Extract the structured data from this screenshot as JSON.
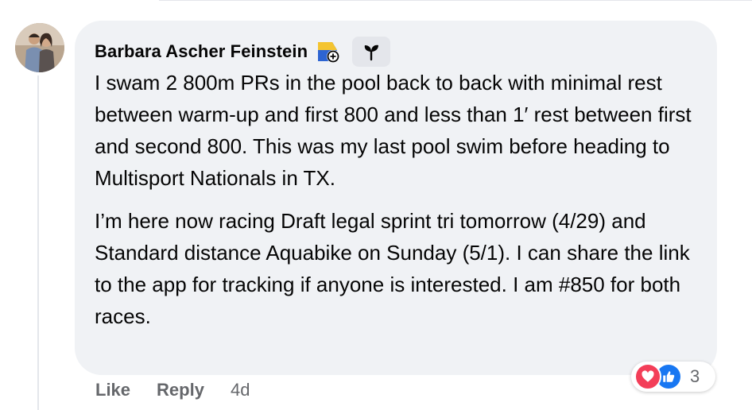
{
  "comment": {
    "author": "Barbara Ascher Feinstein",
    "icons": {
      "badge": "top-fan-badge-icon",
      "sprout": "sprout-icon"
    },
    "paragraphs": [
      "I swam 2 800m PRs in the pool back to back with minimal rest between warm-up and first 800 and less than 1′ rest between first and second 800. This was my last pool swim before heading to Multisport Nationals in TX.",
      "I’m here now racing Draft legal sprint tri tomorrow (4/29) and Standard distance Aquabike on Sunday (5/1). I can share the link to the app for tracking if anyone is interested. I am #850 for both races."
    ],
    "actions": {
      "like": "Like",
      "reply": "Reply",
      "timestamp": "4d"
    },
    "reactions": {
      "types": [
        "love",
        "like"
      ],
      "count": "3"
    }
  },
  "colors": {
    "bubble": "#f0f2f5",
    "secondary_text": "#65676b",
    "love": "#f33e58",
    "like": "#1877f2"
  }
}
